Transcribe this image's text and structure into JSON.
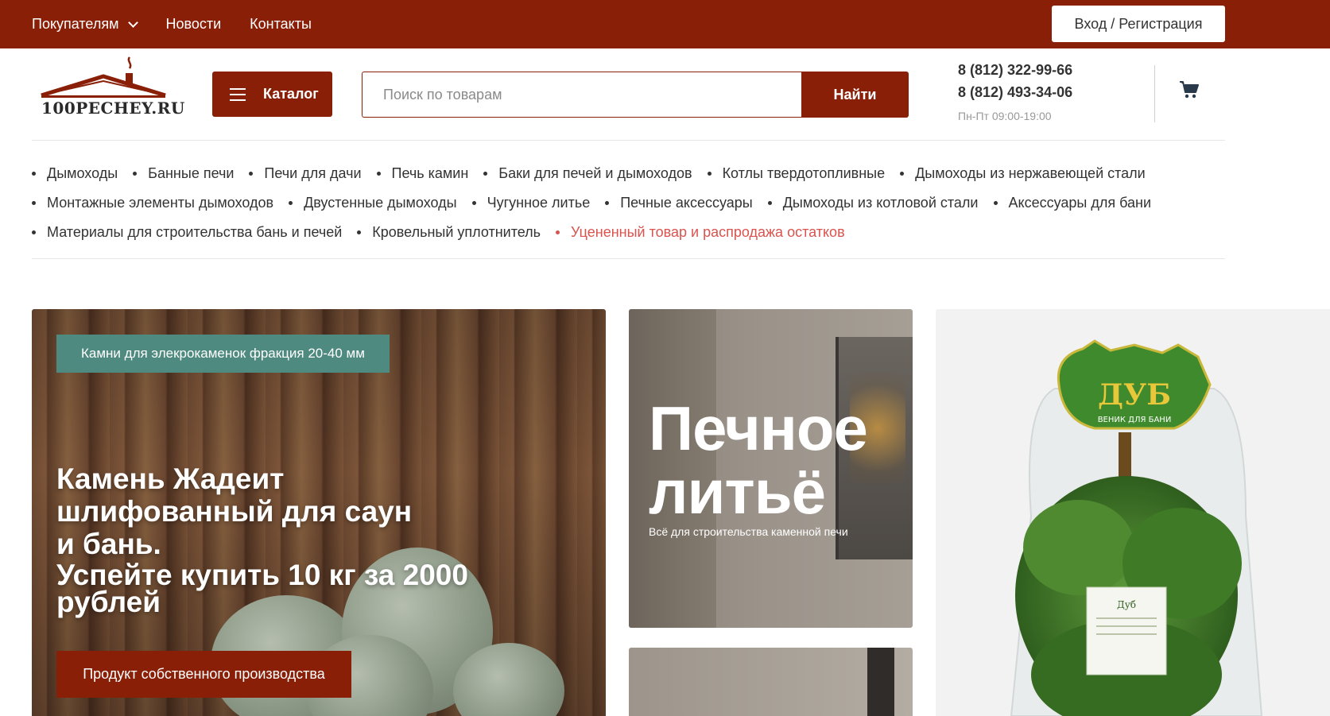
{
  "topbar": {
    "nav": [
      {
        "label": "Покупателям",
        "has_dropdown": true
      },
      {
        "label": "Новости"
      },
      {
        "label": "Контакты"
      }
    ],
    "login_label": "Вход / Регистрация",
    "bg_color": "#8a1f07"
  },
  "header": {
    "logo_text": "100PECHEY.RU",
    "catalog_label": "Каталог",
    "search": {
      "placeholder": "Поиск по товарам",
      "value": "",
      "button_label": "Найти"
    },
    "phones": [
      "8 (812) 322-99-66",
      "8 (812) 493-34-06"
    ],
    "hours": "Пн-Пт 09:00-19:00",
    "cart_icon": "cart-icon"
  },
  "categories": {
    "rows": [
      [
        "Дымоходы",
        "Банные печи",
        "Печи для дачи",
        "Печь камин",
        "Баки для печей и дымоходов",
        "Котлы твердотопливные",
        "Дымоходы из нержавеющей стали"
      ],
      [
        "Монтажные элементы дымоходов",
        "Двустенные дымоходы",
        "Чугунное литье",
        "Печные аксессуары",
        "Дымоходы из котловой стали",
        "Аксессуары для бани"
      ],
      [
        "Материалы для строительства бань и печей",
        "Кровельный уплотнитель"
      ]
    ],
    "sale_item": "Уцененный товар и распродажа остатков",
    "sale_color": "#d9534f"
  },
  "banners": {
    "main": {
      "tag": "Камни для элекрокаменок фракция 20-40 мм",
      "title_line1": "Камень Жадеит",
      "title_line2": "шлифованный для саун",
      "title_line3": "и бань.",
      "subtitle": "Успейте купить 10 кг за 2000 рублей",
      "button": "Продукт собственного производства"
    },
    "cast": {
      "title_line1": "Печное",
      "title_line2": "литьё",
      "subtitle": "Всё для строительства каменной печи"
    },
    "venik": {
      "label_top": "ДУБ",
      "label_sub": "ВЕНИК ДЛЯ БАНИ",
      "tag": "Дуб"
    }
  }
}
